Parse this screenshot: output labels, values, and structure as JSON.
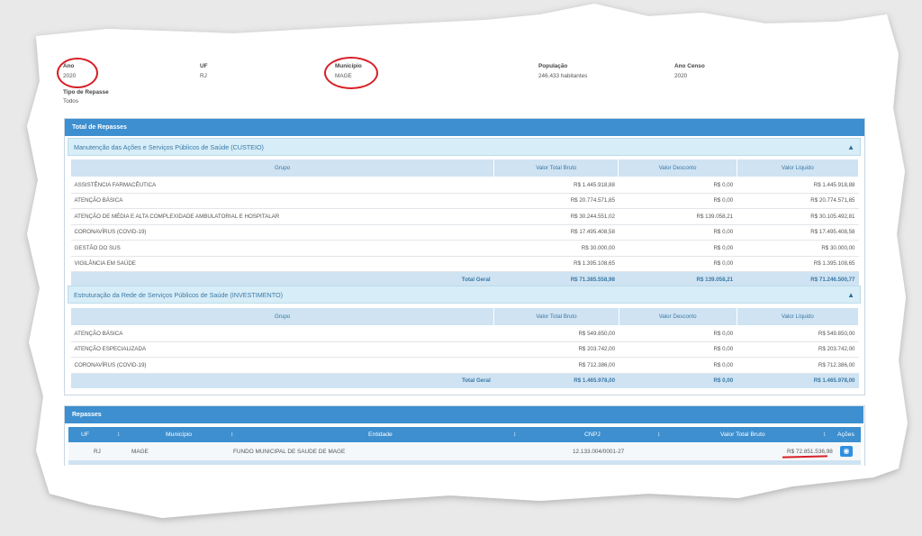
{
  "filters": {
    "ano": {
      "label": "Ano",
      "value": "2020"
    },
    "uf": {
      "label": "UF",
      "value": "RJ"
    },
    "municipio": {
      "label": "Município",
      "value": "MAGE"
    },
    "populacao": {
      "label": "População",
      "value": "246.433 habitantes"
    },
    "ano_censo": {
      "label": "Ano Censo",
      "value": "2020"
    },
    "tipo_repasse": {
      "label": "Tipo de Repasse",
      "value": "Todos"
    }
  },
  "total_panel": {
    "title": "Total de Repasses"
  },
  "custeio": {
    "title": "Manutenção das Ações e Serviços Públicos de Saúde (CUSTEIO)",
    "columns": [
      "Grupo",
      "Valor Total Bruto",
      "Valor Desconto",
      "Valor Líquido"
    ],
    "rows": [
      [
        "ASSISTÊNCIA FARMACÊUTICA",
        "R$ 1.445.918,88",
        "R$ 0,00",
        "R$ 1.445.918,88"
      ],
      [
        "ATENÇÃO BÁSICA",
        "R$ 20.774.571,85",
        "R$ 0,00",
        "R$ 20.774.571,85"
      ],
      [
        "ATENÇÃO DE MÉDIA E ALTA COMPLEXIDADE AMBULATORIAL E HOSPITALAR",
        "R$ 30.244.551,02",
        "R$ 139.058,21",
        "R$ 30.105.492,81"
      ],
      [
        "CORONAVÍRUS (COVID-19)",
        "R$ 17.495.408,58",
        "R$ 0,00",
        "R$ 17.495.408,58"
      ],
      [
        "GESTÃO DO SUS",
        "R$ 30.000,00",
        "R$ 0,00",
        "R$ 30.000,00"
      ],
      [
        "VIGILÂNCIA EM SAÚDE",
        "R$ 1.395.108,65",
        "R$ 0,00",
        "R$ 1.395.108,65"
      ]
    ],
    "total": [
      "Total Geral",
      "R$ 71.385.558,98",
      "R$ 139.058,21",
      "R$ 71.246.500,77"
    ]
  },
  "investimento": {
    "title": "Estruturação da Rede de Serviços Públicos de Saúde (INVESTIMENTO)",
    "columns": [
      "Grupo",
      "Valor Total Bruto",
      "Valor Desconto",
      "Valor Líquido"
    ],
    "rows": [
      [
        "ATENÇÃO BÁSICA",
        "R$ 549.850,00",
        "R$ 0,00",
        "R$ 549.850,00"
      ],
      [
        "ATENÇÃO ESPECIALIZADA",
        "R$ 203.742,00",
        "R$ 0,00",
        "R$ 203.742,00"
      ],
      [
        "CORONAVÍRUS (COVID-19)",
        "R$ 712.386,00",
        "R$ 0,00",
        "R$ 712.386,00"
      ]
    ],
    "total": [
      "Total Geral",
      "R$ 1.465.978,00",
      "R$ 0,00",
      "R$ 1.465.978,00"
    ]
  },
  "repasses": {
    "title": "Repasses",
    "columns": [
      "UF",
      "Município",
      "Entidade",
      "CNPJ",
      "Valor Total Bruto",
      "Ações"
    ],
    "sort_icon": "↕",
    "row": {
      "uf": "RJ",
      "municipio": "MAGE",
      "entidade": "FUNDO MUNICIPAL DE SAUDE DE MAGE",
      "cnpj": "12.133.004/0001-27",
      "valor": "R$ 72.851.536,98"
    }
  },
  "colors": {
    "accent": "#3d8fcf",
    "highlight": "#d71f26"
  }
}
